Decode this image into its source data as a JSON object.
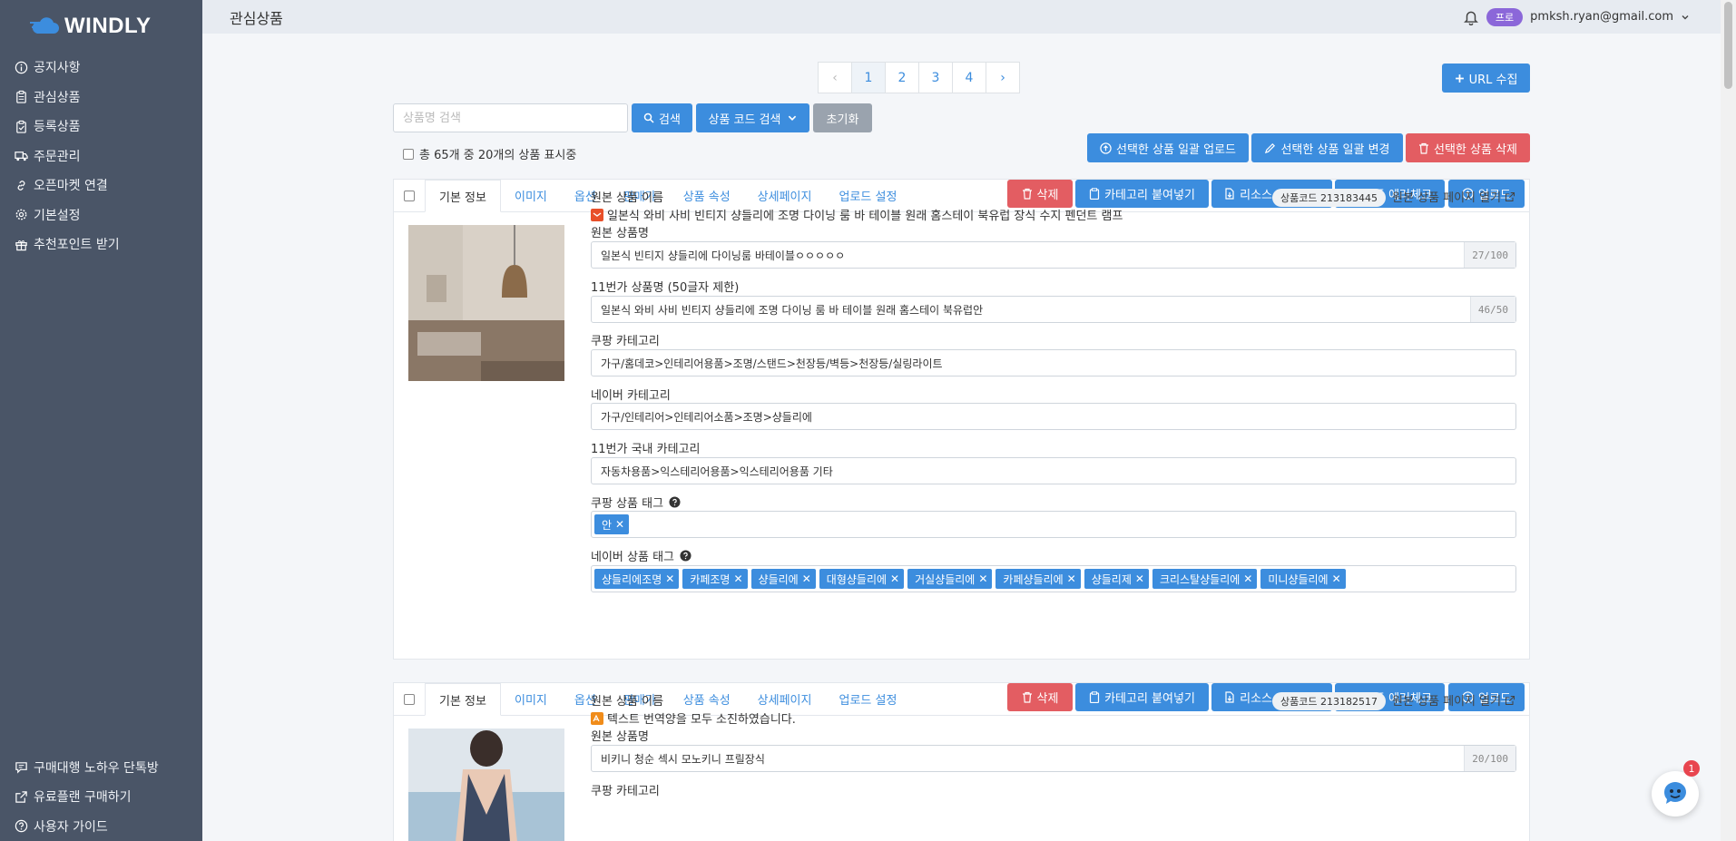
{
  "brand": {
    "name": "WINDLY"
  },
  "nav": {
    "items": [
      {
        "label": "공지사항",
        "icon": "info-icon"
      },
      {
        "label": "관심상품",
        "icon": "clipboard-icon"
      },
      {
        "label": "등록상품",
        "icon": "clipboard-check-icon"
      },
      {
        "label": "주문관리",
        "icon": "truck-icon"
      },
      {
        "label": "오픈마켓 연결",
        "icon": "link-icon"
      },
      {
        "label": "기본설정",
        "icon": "gear-icon"
      },
      {
        "label": "추천포인트 받기",
        "icon": "gift-icon"
      }
    ],
    "bottom": [
      {
        "label": "구매대행 노하우 단톡방",
        "icon": "chat-icon"
      },
      {
        "label": "유료플랜 구매하기",
        "icon": "external-link-icon"
      },
      {
        "label": "사용자 가이드",
        "icon": "help-icon"
      }
    ]
  },
  "header": {
    "title": "관심상품",
    "plan_badge": "프로",
    "email": "pmksh.ryan@gmail.com"
  },
  "pagination": {
    "pages": [
      "1",
      "2",
      "3",
      "4"
    ],
    "current": "1",
    "prev": "‹",
    "next": "›"
  },
  "toolbar": {
    "url_collect": "URL 수집",
    "search_placeholder": "상품명 검색",
    "search_button": "검색",
    "code_search": "상품 코드 검색",
    "reset": "초기화",
    "total_text": "총 65개 중 20개의 상품 표시중",
    "bulk_upload": "선택한 상품 일괄 업로드",
    "bulk_edit": "선택한 상품 일괄 변경",
    "bulk_delete": "선택한 상품 삭제"
  },
  "card_tabs": [
    "기본 정보",
    "이미지",
    "옵션",
    "판매가",
    "상품 속성",
    "상세페이지",
    "업로드 설정"
  ],
  "card_actions": {
    "delete": "삭제",
    "paste_category": "카테고리 붙여넣기",
    "download_resource": "리소스 다운로드",
    "error_check": "상품 에러체크",
    "upload": "업로드"
  },
  "labels": {
    "original_title": "원본 상품 이름",
    "original_name": "원본 상품명",
    "st11_name": "11번가 상품명 (50글자 제한)",
    "coupang_category": "쿠팡 카테고리",
    "naver_category": "네이버 카테고리",
    "st11_category": "11번가 국내 카테고리",
    "coupang_tags": "쿠팡 상품 태그",
    "naver_tags": "네이버 상품 태그",
    "open_original": "원본 상품 페이지 열기"
  },
  "products": [
    {
      "code": "상품코드 213183445",
      "original_title": "일본식 와비 사비 빈티지 샹들리에 조명 다이닝 룸 바 테이블 원래 홈스테이 북유럽 장식 수지 펜던트 램프",
      "original_name": "일본식 빈티지 샹들리에 다이닝룸 바테이블ㅇㅇㅇㅇㅇ",
      "original_name_count": "27/100",
      "st11_name": "일본식 와비 사비 빈티지 샹들리에 조명 다이닝 룸 바 테이블 원래 홈스테이 북유럽안",
      "st11_name_count": "46/50",
      "coupang_category": "가구/홈데코>인테리어용품>조명/스탠드>천장등/벽등>천장등/실링라이트",
      "naver_category": "가구/인테리어>인테리어소품>조명>샹들리에",
      "st11_category": "자동차용품>익스테리어용품>익스테리어용품 기타",
      "coupang_tags": [
        "안"
      ],
      "naver_tags": [
        "샹들리에조명",
        "카페조명",
        "샹들리에",
        "대형샹들리에",
        "거실샹들리에",
        "카페샹들리에",
        "샹들리제",
        "크리스탈샹들리에",
        "미니샹들리에"
      ]
    },
    {
      "code": "상품코드 213182517",
      "original_title": "텍스트 번역양을 모두 소진하였습니다.",
      "original_name": "비키니 청순 섹시 모노키니 프릴장식",
      "original_name_count": "20/100"
    }
  ],
  "chat": {
    "unread": "1"
  },
  "colors": {
    "sidebar": "#4a5567",
    "primary": "#3c8dde",
    "danger": "#e35d62",
    "plan": "#8b67d9"
  }
}
